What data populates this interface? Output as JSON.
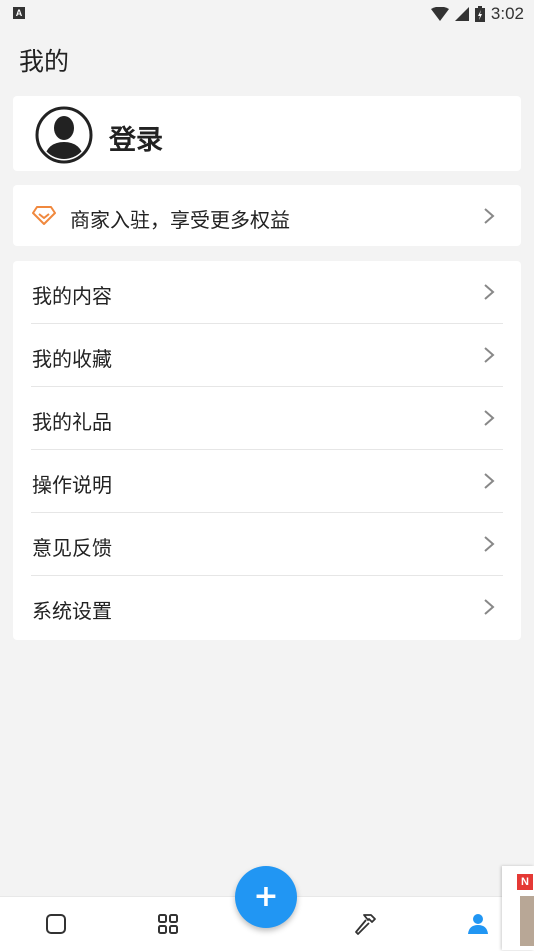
{
  "status_bar": {
    "left_badge": "A",
    "time": "3:02"
  },
  "page": {
    "title": "我的"
  },
  "login": {
    "label": "登录",
    "avatar_icon": "user-silhouette-icon"
  },
  "merchant": {
    "label": "商家入驻，享受更多权益",
    "icon": "diamond-icon",
    "accent_color": "#f0883e"
  },
  "menu": {
    "items": [
      {
        "label": "我的内容"
      },
      {
        "label": "我的收藏"
      },
      {
        "label": "我的礼品"
      },
      {
        "label": "操作说明"
      },
      {
        "label": "意见反馈"
      },
      {
        "label": "系统设置"
      }
    ]
  },
  "bottom_nav": {
    "items": [
      {
        "icon": "square-icon"
      },
      {
        "icon": "grid-icon"
      },
      {
        "icon": "hammer-icon"
      },
      {
        "icon": "person-icon",
        "active": true
      }
    ],
    "fab_label": "+",
    "active_color": "#2196f3"
  },
  "side_widget": {
    "badge": "N"
  }
}
